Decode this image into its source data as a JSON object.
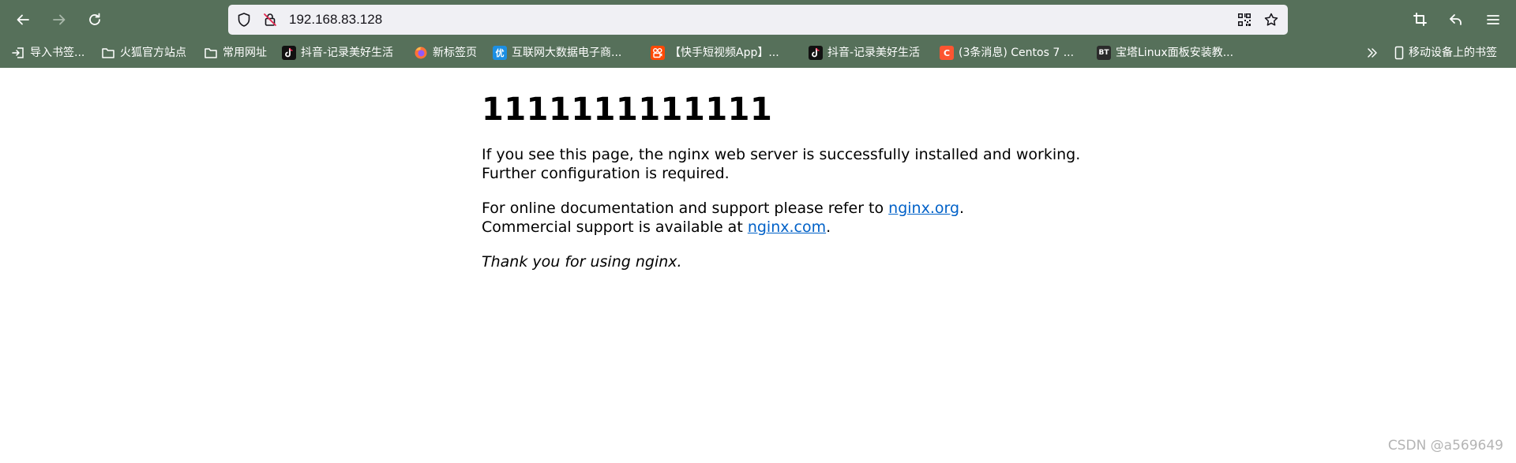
{
  "browser": {
    "url": "192.168.83.128",
    "bookmarks": [
      {
        "label": "导入书签...",
        "icon": "import-icon"
      },
      {
        "label": "火狐官方站点",
        "icon": "folder-icon"
      },
      {
        "label": "常用网址",
        "icon": "folder-icon"
      },
      {
        "label": "抖音-记录美好生活",
        "icon": "tiktok-icon"
      },
      {
        "label": "新标签页",
        "icon": "firefox-icon"
      },
      {
        "label": "互联网大数据电子商...",
        "icon": "you-icon",
        "glyph": "优"
      },
      {
        "label": "【快手短视频App】...",
        "icon": "kuaishou-icon"
      },
      {
        "label": "抖音-记录美好生活",
        "icon": "tiktok-icon"
      },
      {
        "label": "(3条消息) Centos 7 ...",
        "icon": "csdn-icon",
        "glyph": "C"
      },
      {
        "label": "宝塔Linux面板安装教...",
        "icon": "bt-icon",
        "glyph": "BT"
      }
    ],
    "mobile_bookmarks": "移动设备上的书签",
    "colors": {
      "chrome": "#56705a",
      "urlbar": "#f0f0f4"
    }
  },
  "page": {
    "title": "1111111111111",
    "p1": "If you see this page, the nginx web server is successfully installed and working. Further configuration is required.",
    "p2_prefix": "For online documentation and support please refer to ",
    "p2_link": "nginx.org",
    "p2_suffix": ".",
    "p3_prefix": "Commercial support is available at ",
    "p3_link": "nginx.com",
    "p3_suffix": ".",
    "p4": "Thank you for using nginx.",
    "link_color": "#0061c8"
  },
  "watermark": "CSDN @a569649"
}
